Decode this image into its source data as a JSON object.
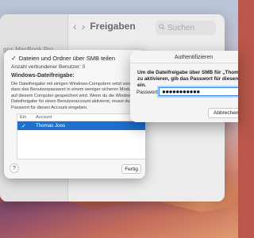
{
  "settings_window": {
    "title": "Freigaben",
    "search_placeholder": "Suchen",
    "sidebar_item": "ggs MacBook Pro",
    "nav_back": "‹",
    "nav_forward": "›"
  },
  "share_sheet": {
    "smb_label": "Dateien und Ordner über SMB teilen",
    "connected_users": "Anzahl verbundener Benutzer: 0",
    "windows_heading": "Windows-Dateifreigabe:",
    "windows_description": "Die Dateifreigabe mit einigen Windows-Computern setzt voraus, dass das Benutzerpasswort in einem weniger sicheren Modus auf diesem Computer gespeichert wird. Wenn du die Windows-Dateifreigabe für einen Benutzeraccount aktivierst, musst du das Passwort für diesen Account eingeben.",
    "table": {
      "headers": [
        "Ein",
        "Account"
      ],
      "rows": [
        {
          "enabled": "✓",
          "account": "Thomas Joos"
        }
      ]
    },
    "help_label": "?",
    "done_label": "Fertig"
  },
  "auth_dialog": {
    "title": "Authentifizieren",
    "message_line1": "Um die Dateifreigabe über SMB für „Thoma",
    "message_line2": "zu aktivieren, gib das Passwort für diesen A",
    "message_line3": "ein.",
    "password_label": "Passwort:",
    "password_value": "●●●●●●●●●●●",
    "cancel_label": "Abbrechen"
  },
  "colors": {
    "selection_blue": "#1f6fcf",
    "focus_ring": "#3b8cf0"
  }
}
